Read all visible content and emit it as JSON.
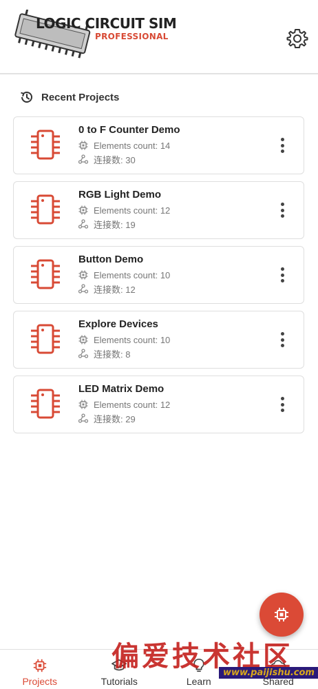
{
  "app": {
    "logo_title": "LOGIC CIRCUIT SIM",
    "logo_subtitle": "PROFESSIONAL"
  },
  "colors": {
    "accent": "#db4a36",
    "card_border": "#dedede",
    "secondary_text": "#777777"
  },
  "icons": {
    "settings": "gear-icon",
    "recent": "history-icon",
    "project": "chip-icon",
    "elements": "cpu-icon",
    "connections": "connection-icon",
    "more": "more-vertical-icon",
    "fab": "add-chip-icon"
  },
  "recent": {
    "title": "Recent Projects"
  },
  "projects": [
    {
      "name": "0 to F Counter Demo",
      "elements": "Elements count: 14",
      "connections": "连接数: 30"
    },
    {
      "name": "RGB Light Demo",
      "elements": "Elements count: 12",
      "connections": "连接数: 19"
    },
    {
      "name": "Button Demo",
      "elements": "Elements count: 10",
      "connections": "连接数: 12"
    },
    {
      "name": "Explore Devices",
      "elements": "Elements count: 10",
      "connections": "连接数: 8"
    },
    {
      "name": "LED Matrix Demo",
      "elements": "Elements count: 12",
      "connections": "连接数: 29"
    }
  ],
  "nav": {
    "items": [
      {
        "label": "Projects",
        "active": true
      },
      {
        "label": "Tutorials",
        "active": false
      },
      {
        "label": "Learn",
        "active": false
      },
      {
        "label": "Shared",
        "active": false
      }
    ]
  },
  "watermark": {
    "text": "偏爱技术社区",
    "url": "www.paijishu.com"
  }
}
